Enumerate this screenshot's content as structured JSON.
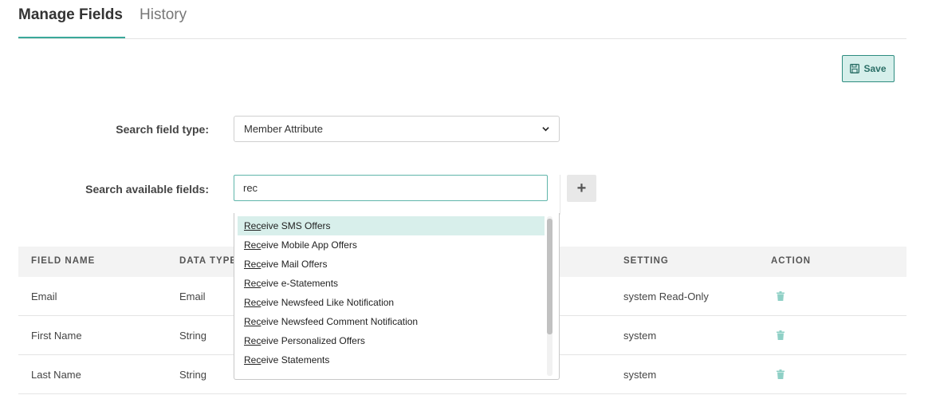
{
  "tabs": [
    {
      "label": "Manage Fields",
      "active": true
    },
    {
      "label": "History",
      "active": false
    }
  ],
  "toolbar": {
    "save_label": "Save",
    "save_icon": "floppy-disk-icon"
  },
  "form": {
    "field_type_label": "Search field type:",
    "field_type_value": "Member Attribute",
    "available_fields_label": "Search available fields:",
    "available_fields_value": "rec",
    "add_button": "+"
  },
  "dropdown": {
    "match": "Rec",
    "items": [
      {
        "match": "Rec",
        "rest": "eive SMS Offers",
        "highlighted": true
      },
      {
        "match": "Rec",
        "rest": "eive Mobile App Offers"
      },
      {
        "match": "Rec",
        "rest": "eive Mail Offers"
      },
      {
        "match": "Rec",
        "rest": "eive e-Statements"
      },
      {
        "match": "Rec",
        "rest": "eive Newsfeed Like Notification"
      },
      {
        "match": "Rec",
        "rest": "eive Newsfeed Comment Notification"
      },
      {
        "match": "Rec",
        "rest": "eive Personalized Offers"
      },
      {
        "match": "Rec",
        "rest": "eive Statements"
      }
    ]
  },
  "table": {
    "columns": [
      "FIELD NAME",
      "DATA TYPE",
      "SETTING",
      "ACTION"
    ],
    "rows": [
      {
        "field_name": "Email",
        "data_type": "Email",
        "setting": "system Read-Only"
      },
      {
        "field_name": "First Name",
        "data_type": "String",
        "setting": "system"
      },
      {
        "field_name": "Last Name",
        "data_type": "String",
        "setting": "system"
      }
    ]
  },
  "colors": {
    "accent": "#3aa89a",
    "highlight": "#d8efeb"
  }
}
